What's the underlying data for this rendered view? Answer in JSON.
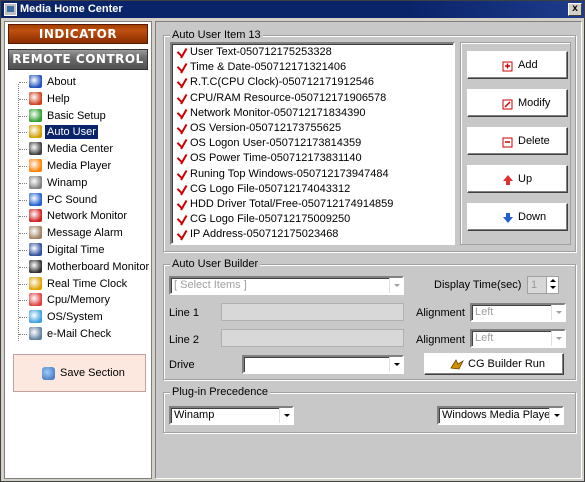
{
  "window": {
    "title": "Media Home Center",
    "close_label": "x"
  },
  "left": {
    "logo_indicator": "INDICATOR",
    "logo_remote": "REMOTE CONTROL",
    "tree": [
      {
        "label": "About",
        "icon": "person-icon",
        "color": "#2050c0"
      },
      {
        "label": "Help",
        "icon": "help-icon",
        "color": "#d04020"
      },
      {
        "label": "Basic Setup",
        "icon": "setup-icon",
        "color": "#30a030"
      },
      {
        "label": "Auto User",
        "icon": "auto-user-icon",
        "color": "#d0a000",
        "selected": true
      },
      {
        "label": "Media Center",
        "icon": "media-center-icon",
        "color": "#404040"
      },
      {
        "label": "Media Player",
        "icon": "media-player-icon",
        "color": "#ff8000"
      },
      {
        "label": "Winamp",
        "icon": "winamp-icon",
        "color": "#808080"
      },
      {
        "label": "PC Sound",
        "icon": "sound-icon",
        "color": "#2060d0"
      },
      {
        "label": "Network Monitor",
        "icon": "network-icon",
        "color": "#d02020"
      },
      {
        "label": "Message Alarm",
        "icon": "alarm-icon",
        "color": "#a08060"
      },
      {
        "label": "Digital Time",
        "icon": "clock-icon",
        "color": "#3050a0"
      },
      {
        "label": "Motherboard Monitor",
        "icon": "motherboard-icon",
        "color": "#303030"
      },
      {
        "label": "Real Time Clock",
        "icon": "rtc-icon",
        "color": "#e0a000"
      },
      {
        "label": "Cpu/Memory",
        "icon": "cpu-icon",
        "color": "#e04040"
      },
      {
        "label": "OS/System",
        "icon": "os-icon",
        "color": "#40a0e0"
      },
      {
        "label": "e-Mail Check",
        "icon": "email-icon",
        "color": "#6080a0"
      }
    ],
    "save_label": "Save Section"
  },
  "auto_user_items": {
    "legend": "Auto User Item 13",
    "items": [
      "User Text-050712175253328",
      "Time & Date-050712171321406",
      "R.T.C(CPU Clock)-050712171912546",
      "CPU/RAM Resource-050712171906578",
      "Network Monitor-050712171834390",
      "OS Version-050712173755625",
      "OS Logon User-050712173814359",
      "OS Power Time-050712173831140",
      "Runing Top Windows-050712173947484",
      "CG Logo File-050712174043312",
      "HDD Driver Total/Free-050712174914859",
      "CG Logo File-050712175009250",
      "IP Address-050712175023468"
    ],
    "buttons": {
      "add": "Add",
      "modify": "Modify",
      "delete": "Delete",
      "up": "Up",
      "down": "Down"
    }
  },
  "builder": {
    "legend": "Auto User Builder",
    "select_placeholder": "[ Select Items ]",
    "display_time_label": "Display Time(sec)",
    "display_time_value": "1",
    "line1_label": "Line 1",
    "line2_label": "Line 2",
    "alignment_label": "Alignment",
    "alignment1_value": "Left",
    "alignment2_value": "Left",
    "drive_label": "Drive",
    "drive_value": "",
    "run_button": "CG Builder Run"
  },
  "plugin": {
    "legend": "Plug-in Precedence",
    "left_value": "Winamp",
    "right_value": "Windows Media Player"
  }
}
